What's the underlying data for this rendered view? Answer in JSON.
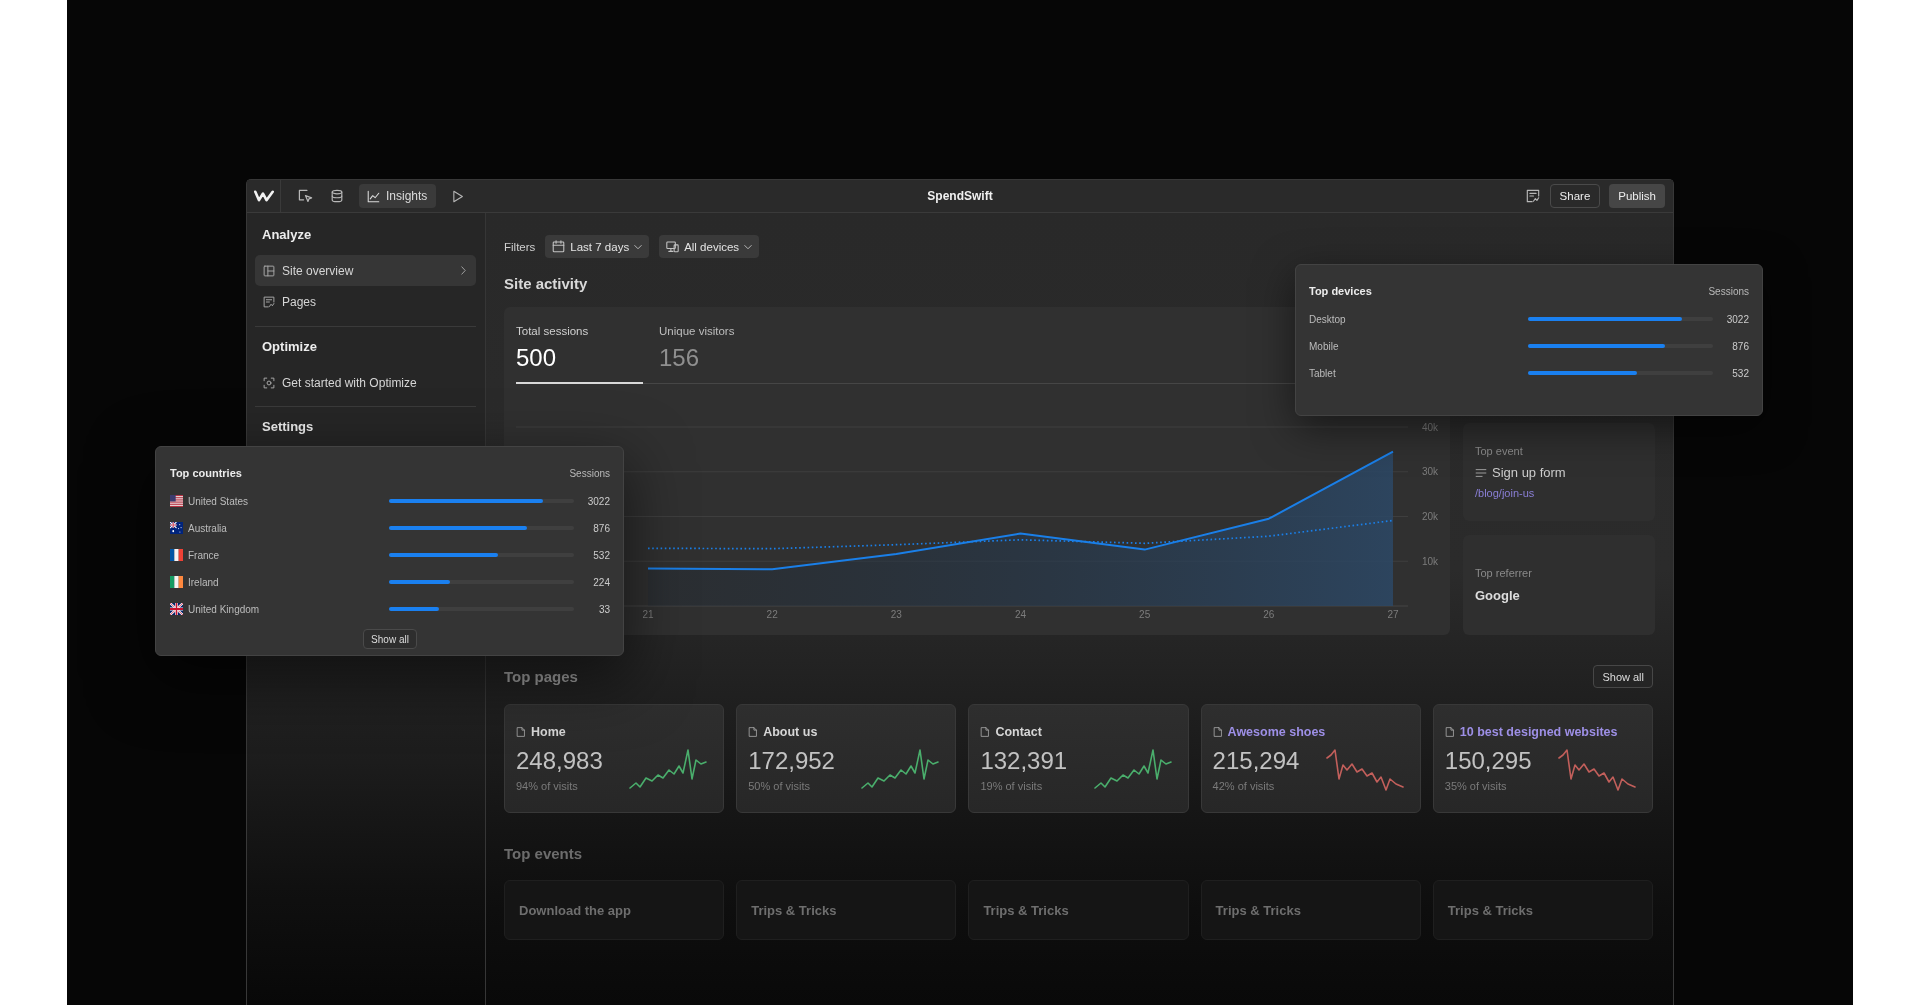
{
  "toolbar": {
    "insights_tab": {
      "label": "Insights",
      "selected": true
    },
    "title": "SpendSwift",
    "buttons": [
      {
        "label": "Share",
        "kind": "outline"
      },
      {
        "label": "Publish",
        "kind": "filled"
      }
    ]
  },
  "sidebar": {
    "sections": [
      {
        "title": "Analyze",
        "items": [
          {
            "label": "Site overview",
            "selected": true
          },
          {
            "label": "Pages",
            "selected": false
          }
        ]
      },
      {
        "title": "Optimize",
        "items": [
          {
            "label": "Get started with Optimize",
            "selected": false
          }
        ]
      },
      {
        "title": "Settings"
      }
    ]
  },
  "filters": {
    "label": "Filters",
    "dropdowns": [
      {
        "value": "Last 7 days"
      },
      {
        "value": "All devices"
      }
    ]
  },
  "site_activity": {
    "title": "Site activity",
    "metrics": [
      {
        "label": "Total sessions",
        "value": "500",
        "selected": true
      },
      {
        "label": "Unique visitors",
        "value": "156",
        "selected": false
      }
    ],
    "chart_data": {
      "type": "area",
      "grid": true,
      "categories": [
        "21",
        "22",
        "23",
        "24",
        "25",
        "26",
        "27"
      ],
      "ylim": [
        0,
        40000
      ],
      "yticks": [
        {
          "value": 10000,
          "label": "10k"
        },
        {
          "value": 20000,
          "label": "20k"
        },
        {
          "value": 30000,
          "label": "30k"
        },
        {
          "value": 40000,
          "label": "40k"
        }
      ],
      "series": [
        {
          "color": "#1a7fe8",
          "line_style": "solid",
          "values": [
            8400,
            8200,
            11600,
            16200,
            12600,
            19500,
            34500
          ]
        },
        {
          "color": "#1a7fe8",
          "line_style": "dotted",
          "type": "line",
          "values": [
            12900,
            12800,
            13700,
            14800,
            14000,
            15600,
            19100
          ]
        }
      ]
    }
  },
  "top_event": {
    "label": "Top event",
    "name": "Sign up form",
    "link": "/blog/join-us"
  },
  "top_referrer": {
    "label": "Top referrer",
    "name": "Google"
  },
  "top_pages": {
    "title": "Top pages",
    "show_all": "Show all",
    "pages": [
      {
        "title": "Home",
        "visits": "248,983",
        "share": "94% of visits",
        "kind": "static",
        "rising": true
      },
      {
        "title": "About us",
        "visits": "172,952",
        "share": "50% of visits",
        "kind": "static",
        "rising": true
      },
      {
        "title": "Contact",
        "visits": "132,391",
        "share": "19% of visits",
        "kind": "static",
        "rising": true
      },
      {
        "title": "Awesome shoes",
        "visits": "215,294",
        "share": "42% of visits",
        "kind": "collection",
        "rising": false
      },
      {
        "title": "10 best designed websites",
        "visits": "150,295",
        "share": "35% of visits",
        "kind": "collection",
        "rising": false
      }
    ]
  },
  "top_events": {
    "title": "Top events",
    "events": [
      {
        "name": "Download the app"
      },
      {
        "name": "Trips & Tricks"
      },
      {
        "name": "Trips & Tricks"
      },
      {
        "name": "Trips & Tricks"
      },
      {
        "name": "Trips & Tricks"
      }
    ]
  },
  "top_devices": {
    "title": "Top devices",
    "column": "Sessions",
    "rows": [
      {
        "name": "Desktop",
        "level": 0.83,
        "value": "3022"
      },
      {
        "name": "Mobile",
        "level": 0.74,
        "value": "876"
      },
      {
        "name": "Tablet",
        "level": 0.59,
        "value": "532"
      }
    ]
  },
  "top_countries": {
    "title": "Top countries",
    "column": "Sessions",
    "rows": [
      {
        "name": "United States",
        "level": 0.83,
        "value": "3022"
      },
      {
        "name": "Australia",
        "level": 0.745,
        "value": "876"
      },
      {
        "name": "France",
        "level": 0.59,
        "value": "532"
      },
      {
        "name": "Ireland",
        "level": 0.33,
        "value": "224"
      },
      {
        "name": "United Kingdom",
        "level": 0.27,
        "value": "33"
      }
    ],
    "show_all": "Show all"
  }
}
